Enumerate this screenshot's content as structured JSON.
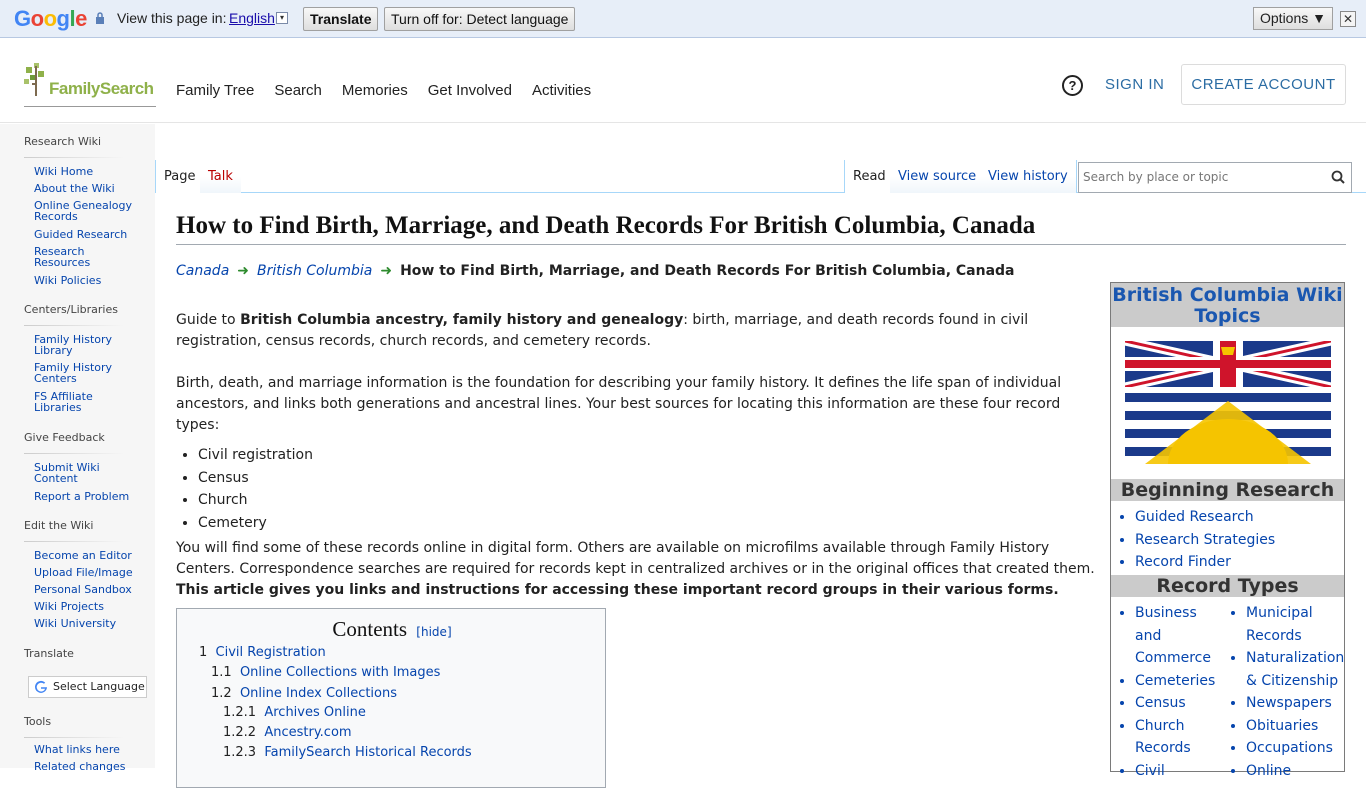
{
  "translate_bar": {
    "view_text": "View this page in:",
    "language": "English",
    "translate_button": "Translate",
    "turn_off_button": "Turn off for: Detect language",
    "options_button": "Options ▼",
    "close": "✕"
  },
  "header": {
    "logo_text": "FamilySearch",
    "nav": [
      "Family Tree",
      "Search",
      "Memories",
      "Get Involved",
      "Activities"
    ],
    "help": "?",
    "sign_in": "SIGN IN",
    "create_account": "CREATE ACCOUNT"
  },
  "sidebar": {
    "sections": [
      {
        "title": "Research Wiki",
        "links": [
          "Wiki Home",
          "About the Wiki",
          "Online Genealogy Records",
          "Guided Research",
          "Research Resources",
          "Wiki Policies"
        ]
      },
      {
        "title": "Centers/Libraries",
        "links": [
          "Family History Library",
          "Family History Centers",
          "FS Affiliate Libraries"
        ]
      },
      {
        "title": "Give Feedback",
        "links": [
          "Submit Wiki Content",
          "Report a Problem"
        ]
      },
      {
        "title": "Edit the Wiki",
        "links": [
          "Become an Editor",
          "Upload File/Image",
          "Personal Sandbox",
          "Wiki Projects",
          "Wiki University"
        ]
      },
      {
        "title": "Translate",
        "links": []
      },
      {
        "title": "Tools",
        "links": [
          "What links here",
          "Related changes"
        ]
      }
    ],
    "translate_widget": "Select Language"
  },
  "tabs": {
    "page": "Page",
    "talk": "Talk",
    "read": "Read",
    "view_source": "View source",
    "view_history": "View history",
    "search_placeholder": "Search by place or topic"
  },
  "article": {
    "title": "How to Find Birth, Marriage, and Death Records For British Columbia, Canada",
    "breadcrumb": [
      "Canada",
      "British Columbia",
      "How to Find Birth, Marriage, and Death Records For British Columbia, Canada"
    ],
    "intro_prefix": "Guide to ",
    "intro_bold": "British Columbia ancestry, family history and genealogy",
    "intro_rest": ": birth, marriage, and death records found in civil registration, census records, church records, and cemetery records.",
    "para2": "Birth, death, and marriage information is the foundation for describing your family history. It defines the life span of individual ancestors, and links both generations and ancestral lines. Your best sources for locating this information are these four record types:",
    "record_types": [
      "Civil registration",
      "Census",
      "Church",
      "Cemetery"
    ],
    "para3": "You will find some of these records online in digital form. Others are available on microfilms available through Family History Centers. Correspondence searches are required for records kept in centralized archives or in the original offices that created them.",
    "para3_bold": "This article gives you links and instructions for accessing these important record groups in their various forms."
  },
  "toc": {
    "title": "Contents",
    "hide": "hide",
    "entries": [
      {
        "num": "1",
        "text": "Civil Registration"
      },
      {
        "num": "1.1",
        "text": "Online Collections with Images"
      },
      {
        "num": "1.2",
        "text": "Online Index Collections"
      },
      {
        "num": "1.2.1",
        "text": "Archives Online"
      },
      {
        "num": "1.2.2",
        "text": "Ancestry.com"
      },
      {
        "num": "1.2.3",
        "text": "FamilySearch Historical Records"
      }
    ]
  },
  "infobox": {
    "title": "British Columbia Wiki Topics",
    "beginning_heading": "Beginning Research",
    "beginning_links": [
      "Guided Research",
      "Research Strategies",
      "Record Finder"
    ],
    "record_types_heading": "Record Types",
    "col1": [
      "Business and Commerce",
      "Cemeteries",
      "Census",
      "Church Records",
      "Civil"
    ],
    "col2": [
      "Municipal Records",
      "Naturalization & Citizenship",
      "Newspapers",
      "Obituaries",
      "Occupations",
      "Online"
    ]
  }
}
